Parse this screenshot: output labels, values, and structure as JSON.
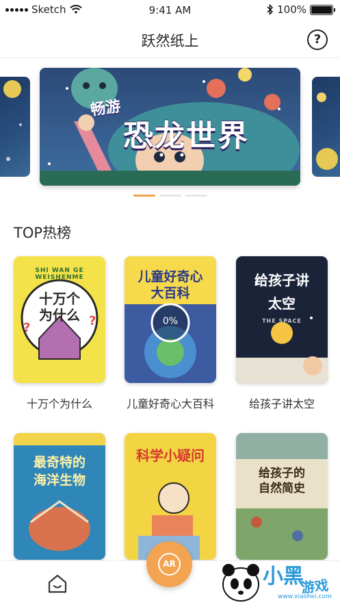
{
  "status_bar": {
    "carrier": "Sketch",
    "time": "9:41 AM",
    "battery": "100%",
    "battery_level": 1.0
  },
  "nav": {
    "title": "跃然纸上",
    "help_icon": "question-circle-icon"
  },
  "banner": {
    "tag": "畅游",
    "title": "恐龙世界",
    "pages": 3,
    "active_page": 0
  },
  "section": {
    "title": "TOP热榜"
  },
  "books": [
    {
      "title": "十万个为什么",
      "cover_title": "十万个\n为什么",
      "cover_subtitle": "SHI WAN GE WEISHENME",
      "color": "#f4e24a"
    },
    {
      "title": "儿童好奇心大百科",
      "cover_title": "儿童好奇心\n大百科",
      "color": "#3d5ba0"
    },
    {
      "title": "给孩子讲太空",
      "cover_title": "给孩子讲\n太空",
      "cover_subtitle": "THE SPACE",
      "color": "#1a2338"
    },
    {
      "title": "",
      "cover_title": "最奇特的\n海洋生物",
      "color": "#2f86b8"
    },
    {
      "title": "",
      "cover_title": "科学小疑问",
      "color": "#f3d443"
    },
    {
      "title": "",
      "cover_title": "给孩子的\n自然简史",
      "color": "#e9e2c8"
    }
  ],
  "progress": {
    "label": "0%",
    "value": 0
  },
  "tab_bar": {
    "home_icon": "home-icon",
    "ar_label": "AR"
  },
  "watermark": {
    "brand": "小黑",
    "brand2": "游戏",
    "url": "www.xiaohei.com"
  }
}
